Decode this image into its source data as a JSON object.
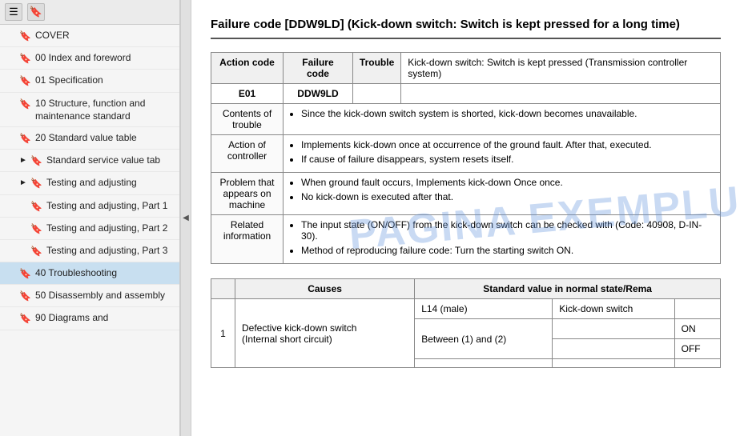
{
  "sidebar": {
    "toolbar": {
      "icon1": "☰",
      "icon2": "🔖"
    },
    "items": [
      {
        "id": "cover",
        "label": "COVER",
        "indent": 0,
        "has_arrow": false,
        "active": false
      },
      {
        "id": "00-index",
        "label": "00 Index and foreword",
        "indent": 0,
        "has_arrow": false,
        "active": false
      },
      {
        "id": "01-spec",
        "label": "01 Specification",
        "indent": 0,
        "has_arrow": false,
        "active": false
      },
      {
        "id": "10-structure",
        "label": "10 Structure, function and maintenance standard",
        "indent": 0,
        "has_arrow": false,
        "active": false
      },
      {
        "id": "20-standard",
        "label": "20 Standard value table",
        "indent": 0,
        "has_arrow": false,
        "active": false
      },
      {
        "id": "std-service",
        "label": "Standard service value tab",
        "indent": 1,
        "has_arrow": true,
        "active": false
      },
      {
        "id": "testing-adj",
        "label": "Testing and adjusting",
        "indent": 1,
        "has_arrow": true,
        "active": false
      },
      {
        "id": "testing-p1",
        "label": "Testing and adjusting, Part 1",
        "indent": 1,
        "has_arrow": false,
        "active": false
      },
      {
        "id": "testing-p2",
        "label": "Testing and adjusting, Part 2",
        "indent": 1,
        "has_arrow": false,
        "active": false
      },
      {
        "id": "testing-p3",
        "label": "Testing and adjusting, Part 3",
        "indent": 1,
        "has_arrow": false,
        "active": false
      },
      {
        "id": "40-trouble",
        "label": "40 Troubleshooting",
        "indent": 0,
        "has_arrow": false,
        "active": true
      },
      {
        "id": "50-disassembly",
        "label": "50 Disassembly and assembly",
        "indent": 0,
        "has_arrow": false,
        "active": false
      },
      {
        "id": "90-diagrams",
        "label": "90 Diagrams and",
        "indent": 0,
        "has_arrow": false,
        "active": false
      }
    ]
  },
  "main": {
    "title": "Failure code [DDW9LD] (Kick-down switch: Switch is kept pressed for a long time)",
    "info_table": {
      "action_code_header": "Action code",
      "failure_code_header": "Failure code",
      "trouble_header": "Trouble",
      "action_code_value": "E01",
      "failure_code_value": "DDW9LD",
      "trouble_desc": "Kick-down switch: Switch is kept pressed (Transmission controller system)",
      "rows": [
        {
          "label": "Contents of trouble",
          "content": "• Since the kick-down switch system is shorted, kick-down becomes unavailable."
        },
        {
          "label": "Action of controller",
          "content": "• Implements kick-down once at occurrence of the ground fault. After that, executed.\n• If cause of failure disappears, system resets itself."
        },
        {
          "label": "Problem that appears on machine",
          "content": "• When ground fault occurs, Implements kick-down Once once.\n No kick-down is executed after that."
        },
        {
          "label": "Related information",
          "content": "• The input state (ON/OFF) from the kick-down switch can be checked with (Code: 40908, D-IN-30).\n• Method of reproducing failure code: Turn the starting switch ON."
        }
      ]
    },
    "causes_table": {
      "causes_header": "Causes",
      "standard_header": "Standard value in normal state/Rema",
      "rows": [
        {
          "num": "1",
          "cause": "Defective kick-down switch (Internal short circuit)",
          "sub_rows": [
            {
              "condition": "L14 (male)",
              "measure": "Kick-down switch",
              "values": [
                {
                  "state": "ON",
                  "value": ""
                },
                {
                  "state": "OFF",
                  "value": ""
                }
              ]
            },
            {
              "condition": "Between (1) and (2)",
              "measure": "",
              "values": [
                {
                  "state": "ON",
                  "value": ""
                },
                {
                  "state": "OFF",
                  "value": ""
                }
              ]
            }
          ]
        }
      ]
    },
    "watermark_line1": "PAGINA EXEMPLU"
  }
}
